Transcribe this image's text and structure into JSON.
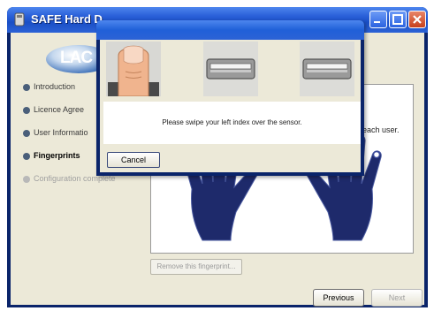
{
  "window": {
    "title": "SAFE Hard D"
  },
  "logo": {
    "text": "LAC"
  },
  "steps": [
    {
      "label": "Introduction",
      "state": "done"
    },
    {
      "label": "Licence Agree",
      "state": "done"
    },
    {
      "label": "User Informatio",
      "state": "done"
    },
    {
      "label": "Fingerprints",
      "state": "active"
    },
    {
      "label": "Configuration complete",
      "state": "pending"
    }
  ],
  "main": {
    "instructions_tail": "each user.",
    "remove_label": "Remove this fingerprint...",
    "previous_label": "Previous",
    "next_label": "Next"
  },
  "dialog": {
    "message": "Please swipe your left index over the sensor.",
    "cancel_label": "Cancel"
  },
  "colors": {
    "title_bar": "#2a60d8",
    "hand": "#1e2a6b",
    "accent": "#0a246a"
  },
  "icons": [
    "app-icon",
    "minimize-icon",
    "maximize-icon",
    "close-icon",
    "finger-on-sensor-icon",
    "sensor-icon"
  ]
}
